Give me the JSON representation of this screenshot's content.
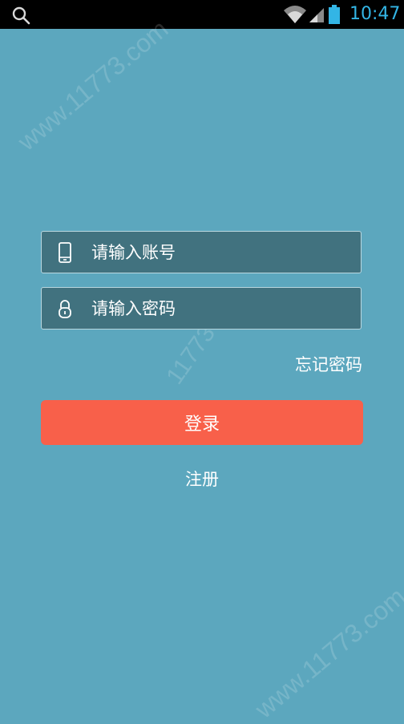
{
  "status_bar": {
    "time": "10:47",
    "icons": [
      "search-icon",
      "wifi-icon",
      "signal-icon",
      "battery-icon"
    ],
    "time_color": "#33b5e5"
  },
  "watermark": {
    "text_main": "www.11773.com",
    "text_center": "11773"
  },
  "login_form": {
    "account_placeholder": "请输入账号",
    "password_placeholder": "请输入密码",
    "account_icon": "phone-icon",
    "password_icon": "lock-icon",
    "forgot_password_label": "忘记密码",
    "login_button_label": "登录",
    "register_label": "注册"
  },
  "colors": {
    "background": "#5ca7be",
    "field_background": "#41727f",
    "login_button": "#f8604a"
  }
}
